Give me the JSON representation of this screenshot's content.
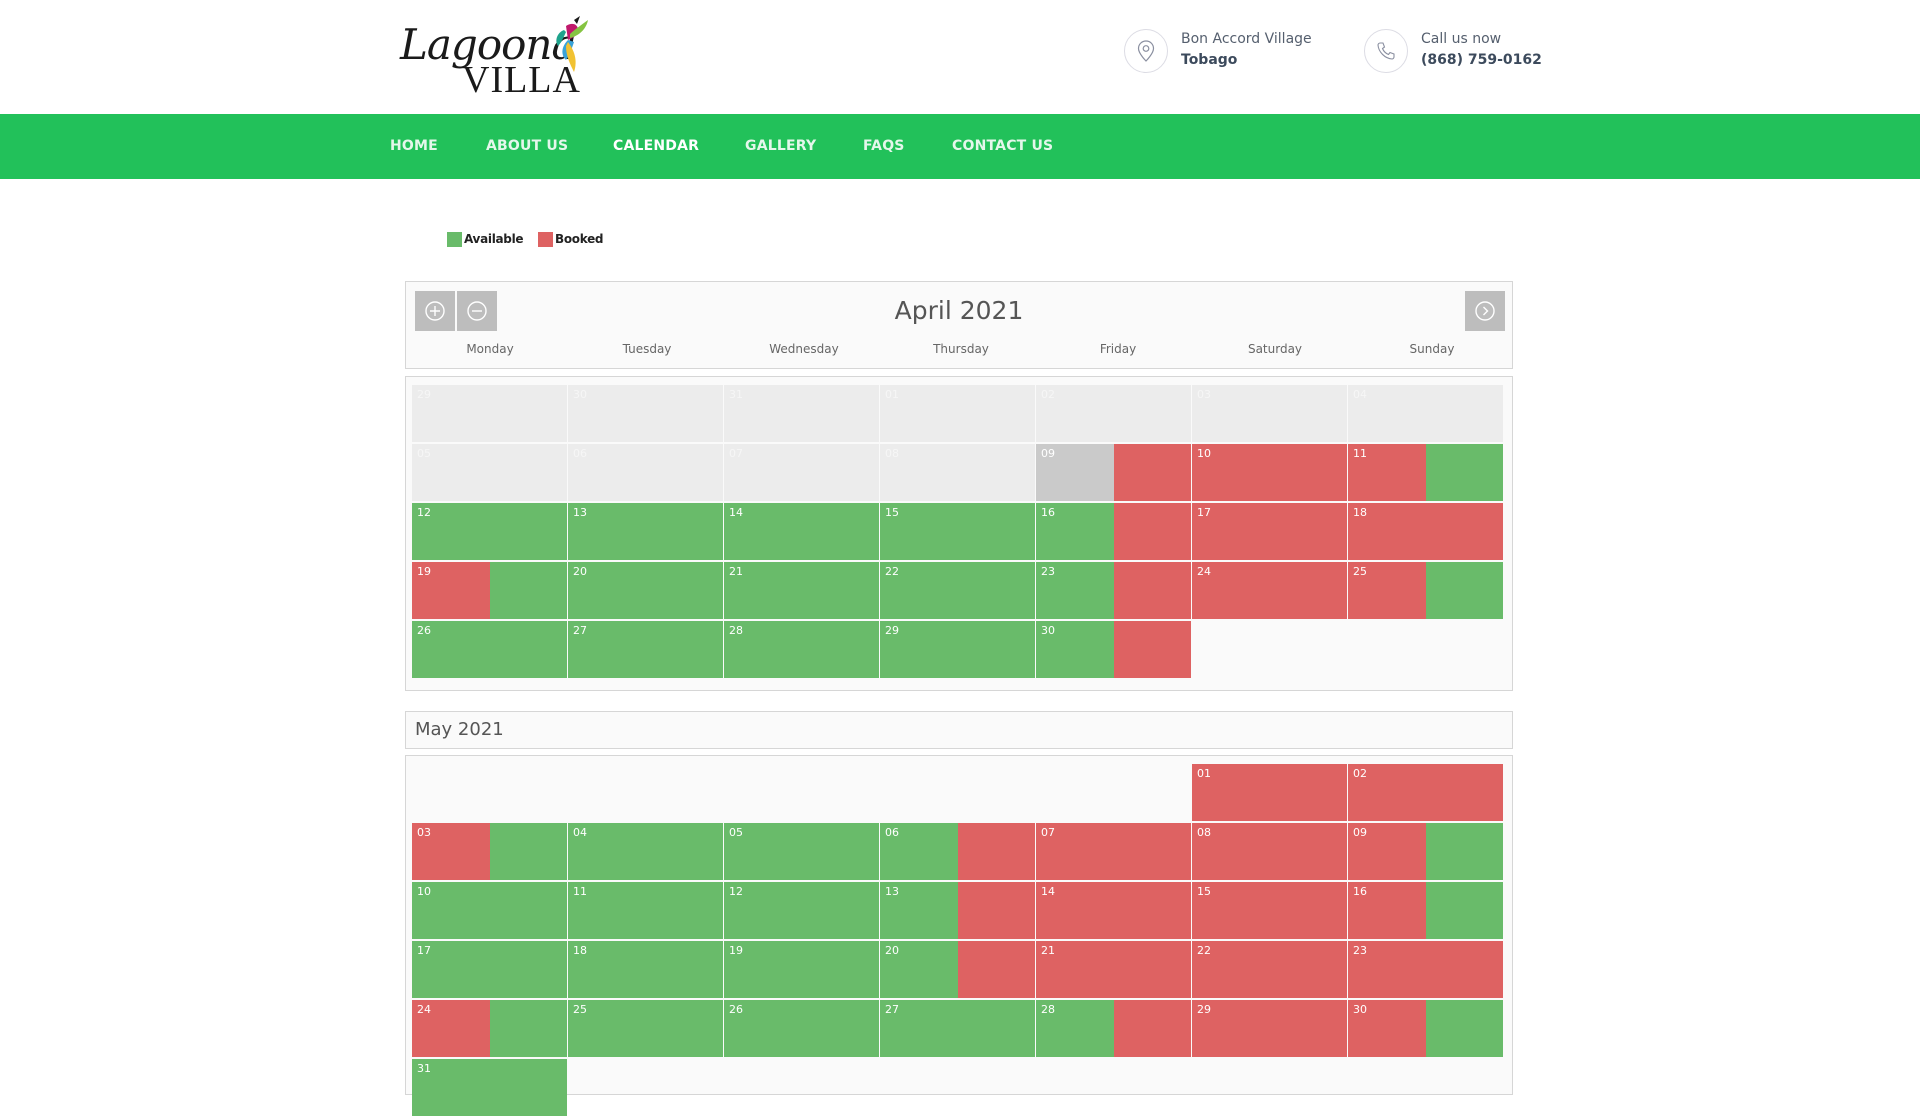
{
  "header": {
    "logo_text_1": "Lagoona",
    "logo_text_2": "VILLA",
    "location_line1": "Bon Accord Village",
    "location_line2": "Tobago",
    "phone_line1": "Call us now",
    "phone_line2": "(868) 759-0162"
  },
  "nav": {
    "items": [
      "HOME",
      "ABOUT US",
      "CALENDAR",
      "GALLERY",
      "FAQS",
      "CONTACT US"
    ],
    "active": "CALENDAR"
  },
  "legend": {
    "available_label": "Available",
    "booked_label": "Booked",
    "available_color": "#69bb6a",
    "booked_color": "#de6262"
  },
  "calendar": {
    "title": "April 2021",
    "weekdays": [
      "Monday",
      "Tuesday",
      "Wednesday",
      "Thursday",
      "Friday",
      "Saturday",
      "Sunday"
    ],
    "months": [
      {
        "name": "April 2021",
        "days": [
          {
            "n": "29",
            "s": "x"
          },
          {
            "n": "30",
            "s": "x"
          },
          {
            "n": "31",
            "s": "x"
          },
          {
            "n": "01",
            "s": "x"
          },
          {
            "n": "02",
            "s": "x"
          },
          {
            "n": "03",
            "s": "x"
          },
          {
            "n": "04",
            "s": "x"
          },
          {
            "n": "05",
            "s": "x"
          },
          {
            "n": "06",
            "s": "x"
          },
          {
            "n": "07",
            "s": "x"
          },
          {
            "n": "08",
            "s": "x"
          },
          {
            "n": "09",
            "s": "p-r"
          },
          {
            "n": "10",
            "s": "r"
          },
          {
            "n": "11",
            "s": "r-g"
          },
          {
            "n": "12",
            "s": "g"
          },
          {
            "n": "13",
            "s": "g"
          },
          {
            "n": "14",
            "s": "g"
          },
          {
            "n": "15",
            "s": "g"
          },
          {
            "n": "16",
            "s": "g-r"
          },
          {
            "n": "17",
            "s": "r"
          },
          {
            "n": "18",
            "s": "r"
          },
          {
            "n": "19",
            "s": "r-g"
          },
          {
            "n": "20",
            "s": "g"
          },
          {
            "n": "21",
            "s": "g"
          },
          {
            "n": "22",
            "s": "g"
          },
          {
            "n": "23",
            "s": "g-r"
          },
          {
            "n": "24",
            "s": "r"
          },
          {
            "n": "25",
            "s": "r-g"
          },
          {
            "n": "26",
            "s": "g"
          },
          {
            "n": "27",
            "s": "g"
          },
          {
            "n": "28",
            "s": "g"
          },
          {
            "n": "29",
            "s": "g"
          },
          {
            "n": "30",
            "s": "g-r"
          },
          {
            "n": "",
            "s": "empty"
          },
          {
            "n": "",
            "s": "empty"
          }
        ]
      },
      {
        "name": "May 2021",
        "days": [
          {
            "n": "",
            "s": "empty"
          },
          {
            "n": "",
            "s": "empty"
          },
          {
            "n": "",
            "s": "empty"
          },
          {
            "n": "",
            "s": "empty"
          },
          {
            "n": "",
            "s": "empty"
          },
          {
            "n": "01",
            "s": "r"
          },
          {
            "n": "02",
            "s": "r"
          },
          {
            "n": "03",
            "s": "r-g"
          },
          {
            "n": "04",
            "s": "g"
          },
          {
            "n": "05",
            "s": "g"
          },
          {
            "n": "06",
            "s": "g-r"
          },
          {
            "n": "07",
            "s": "r"
          },
          {
            "n": "08",
            "s": "r"
          },
          {
            "n": "09",
            "s": "r-g"
          },
          {
            "n": "10",
            "s": "g"
          },
          {
            "n": "11",
            "s": "g"
          },
          {
            "n": "12",
            "s": "g"
          },
          {
            "n": "13",
            "s": "g-r"
          },
          {
            "n": "14",
            "s": "r"
          },
          {
            "n": "15",
            "s": "r"
          },
          {
            "n": "16",
            "s": "r-g"
          },
          {
            "n": "17",
            "s": "g"
          },
          {
            "n": "18",
            "s": "g"
          },
          {
            "n": "19",
            "s": "g"
          },
          {
            "n": "20",
            "s": "g-r"
          },
          {
            "n": "21",
            "s": "r"
          },
          {
            "n": "22",
            "s": "r"
          },
          {
            "n": "23",
            "s": "r"
          },
          {
            "n": "24",
            "s": "r-g"
          },
          {
            "n": "25",
            "s": "g"
          },
          {
            "n": "26",
            "s": "g"
          },
          {
            "n": "27",
            "s": "g"
          },
          {
            "n": "28",
            "s": "g-r"
          },
          {
            "n": "29",
            "s": "r"
          },
          {
            "n": "30",
            "s": "r-g"
          },
          {
            "n": "31",
            "s": "g"
          }
        ]
      }
    ]
  },
  "icons": {
    "location": "map-pin-icon",
    "phone": "phone-icon",
    "zoom_in": "plus-circle-icon",
    "zoom_out": "minus-circle-icon",
    "next": "chevron-right-circle-icon"
  }
}
